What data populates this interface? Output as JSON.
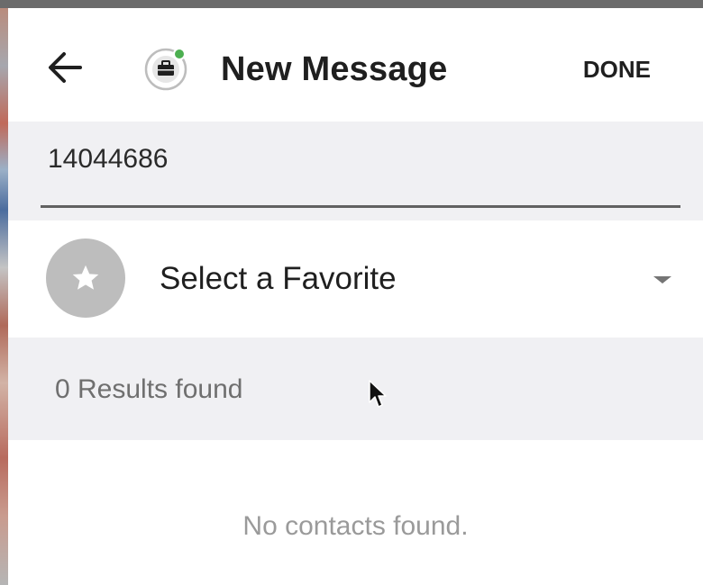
{
  "header": {
    "title": "New Message",
    "done_label": "DONE",
    "back_icon": "arrow-left-icon",
    "app_icon": "briefcase-icon",
    "presence_color": "#4caf50"
  },
  "search": {
    "value": "14044686"
  },
  "favorite": {
    "label": "Select a Favorite",
    "icon": "star-icon",
    "dropdown_icon": "caret-down-icon"
  },
  "results": {
    "count_text": "0 Results found"
  },
  "empty_state": {
    "text": "No contacts found."
  },
  "colors": {
    "panel_gray": "#f0f0f3",
    "text_primary": "#1f1f1f",
    "text_secondary": "#6f6f6f",
    "favorite_circle": "#bdbdbd"
  }
}
